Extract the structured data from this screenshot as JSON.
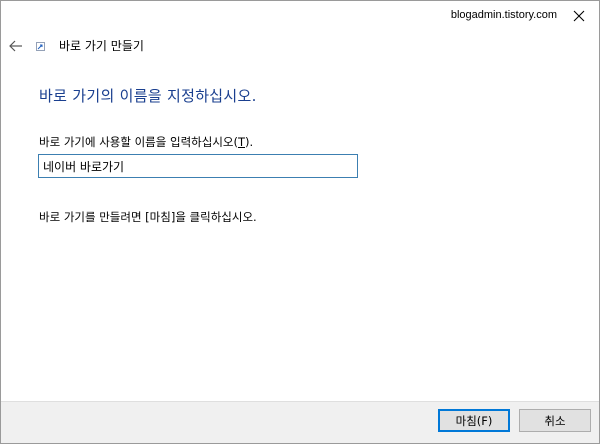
{
  "titlebar": {
    "app_text": "blogadmin.tistory.com",
    "close_glyph": "✕"
  },
  "nav": {
    "back_glyph": "←",
    "wizard_title": "바로 가기 만들기"
  },
  "main": {
    "heading": "바로 가기의 이름을 지정하십시오.",
    "field_label_prefix": "바로 가기에 사용할 이름을 입력하십시오(",
    "field_label_mnemonic": "T",
    "field_label_suffix": ").",
    "name_value": "네이버 바로가기",
    "hint": "바로 가기를 만들려면 [마침]을 클릭하십시오."
  },
  "footer": {
    "finish_label": "마침(F)",
    "cancel_label": "취소"
  },
  "colors": {
    "heading": "#1a3f8f",
    "accent": "#0078d7",
    "footer_bg": "#f0f0f0"
  },
  "icons": [
    "close-icon",
    "back-arrow-icon",
    "shortcut-wizard-icon"
  ]
}
